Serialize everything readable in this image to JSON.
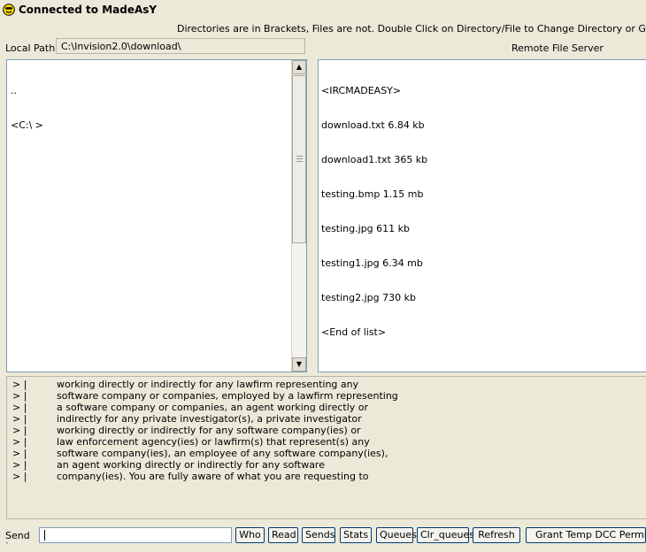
{
  "window": {
    "title": "Connected to MadeAsY"
  },
  "info_text": "Directories are in Brackets, Files are not. Double Click on Directory/File to Change Directory or Get File",
  "local": {
    "path_label": "Local Path:",
    "path_value": "C:\\Invision2.0\\download\\",
    "items": [
      "..",
      "<C:\\ >"
    ]
  },
  "remote": {
    "label": "Remote File Server",
    "items": [
      "<IRCMADEASY>",
      "download.txt 6.84 kb",
      "download1.txt 365 kb",
      "testing.bmp 1.15 mb",
      "testing.jpg 611 kb",
      "testing1.jpg 6.34 mb",
      "testing2.jpg 730 kb",
      "<End of list>"
    ]
  },
  "chat": {
    "prefix": "> |",
    "lines": [
      "working directly or indirectly for any lawfirm representing any",
      "software company or companies, employed by a lawfirm representing",
      "a software company or companies, an agent working directly or",
      "indirectly for any private investigator(s), a private investigator",
      "working directly or indirectly for any software company(ies) or",
      "law enforcement agency(ies) or lawfirm(s) that represent(s) any",
      "software company(ies), an employee of any software company(ies),",
      "an agent working directly or indirectly for any software",
      "company(ies). You are fully aware of what you are requesting to"
    ]
  },
  "send": {
    "label": "Send",
    "value": "",
    "buttons": {
      "who": "Who",
      "read": "Read",
      "sends": "Sends",
      "stats": "Stats",
      "queues": "Queues",
      "clr_queues": "Clr_queues",
      "refresh": "Refresh",
      "grant": "Grant Temp DCC Permission"
    }
  }
}
